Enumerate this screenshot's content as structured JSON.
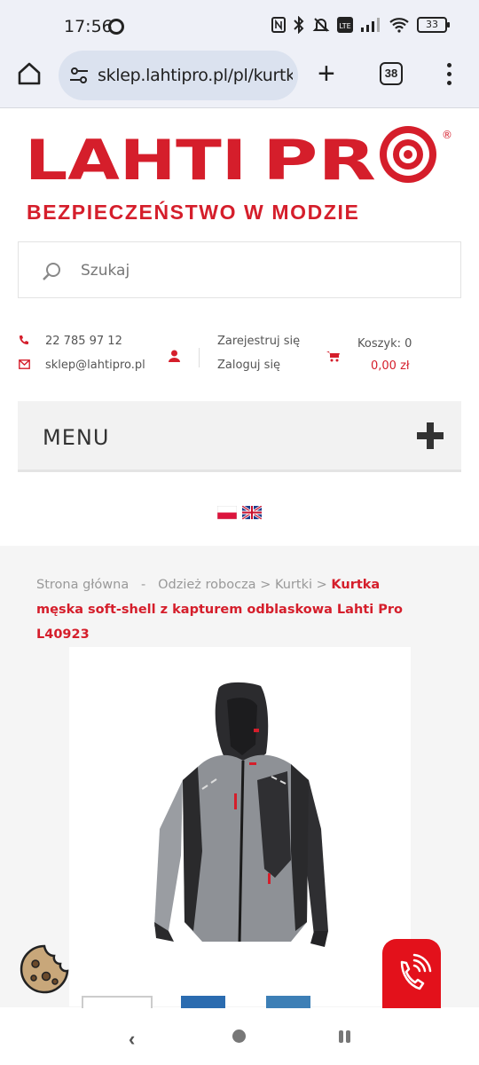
{
  "status_bar": {
    "time": "17:56",
    "battery": "33"
  },
  "browser": {
    "url": "sklep.lahtipro.pl/pl/kurtki-",
    "tab_count": "38"
  },
  "header": {
    "brand": "LAHTI PRO",
    "tagline": "BEZPIECZEŃSTWO W MODZIE",
    "search_placeholder": "Szukaj"
  },
  "contact": {
    "phone": "22 785 97 12",
    "email": "sklep@lahtipro.pl"
  },
  "account": {
    "register": "Zarejestruj się",
    "login": "Zaloguj się"
  },
  "cart": {
    "label": "Koszyk: 0",
    "total": "0,00 zł"
  },
  "menu": {
    "label": "MENU"
  },
  "breadcrumb": {
    "home": "Strona główna",
    "sep1": "-",
    "category": "Odzież robocza",
    "sep2": ">",
    "subcategory": "Kurtki",
    "sep3": ">",
    "current": "Kurtka męska soft-shell z kapturem odblaskowa Lahti Pro L40923"
  },
  "colors": {
    "brand_red": "#d51e2b",
    "call_red": "#e3111b"
  }
}
